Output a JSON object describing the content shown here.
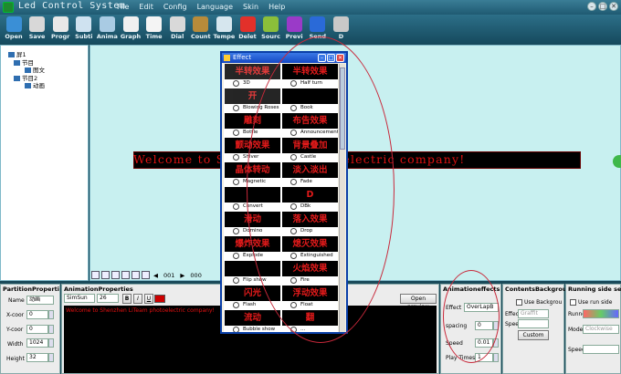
{
  "window": {
    "title": "Led Control System",
    "close": "✕",
    "minimize": "–",
    "maximize": "□"
  },
  "menu": [
    "File",
    "Edit",
    "Config",
    "Language",
    "Skin",
    "Help"
  ],
  "toolbar": [
    {
      "label": "Open",
      "icon": "folder-open-icon",
      "color": "#3a8fd6"
    },
    {
      "label": "Save",
      "icon": "floppy-disk-icon",
      "color": "#d8d8d8"
    },
    {
      "label": "Progr",
      "icon": "program-icon",
      "color": "#e8e8e8"
    },
    {
      "label": "Subti",
      "icon": "subtitle-icon",
      "color": "#cfe2f0"
    },
    {
      "label": "Anima",
      "icon": "animation-icon",
      "color": "#a9cbe3"
    },
    {
      "label": "Graph",
      "icon": "graph-icon",
      "color": "#f0f0f0"
    },
    {
      "label": "Time",
      "icon": "time-icon",
      "color": "#f4f4f4"
    },
    {
      "label": "Dial",
      "icon": "dial-clock-icon",
      "color": "#d9d9d9"
    },
    {
      "label": "Count",
      "icon": "hourglass-icon",
      "color": "#b88b3a"
    },
    {
      "label": "Tempe",
      "icon": "temperature-cloud-icon",
      "color": "#d6e6ee"
    },
    {
      "label": "Delet",
      "icon": "delete-x-icon",
      "color": "#e2302a"
    },
    {
      "label": "Sourc",
      "icon": "source-icon",
      "color": "#8bbf3a"
    },
    {
      "label": "Previ",
      "icon": "preview-play-icon",
      "color": "#9a3ac8"
    },
    {
      "label": "Send",
      "icon": "send-icon",
      "color": "#2a6ad8"
    },
    {
      "label": "D",
      "icon": "download-icon",
      "color": "#c8c8c8"
    }
  ],
  "tree": [
    {
      "label": "屏1"
    },
    {
      "label": "节目"
    },
    {
      "label": "图文"
    },
    {
      "label": "节目2"
    },
    {
      "label": "动画"
    }
  ],
  "canvas": {
    "led_text": "Welcome to Shenzhen  in photoelectric company!"
  },
  "navbar": {
    "page": "001",
    "count": "000"
  },
  "partition": {
    "title": "PartitionProperti",
    "name_label": "Name",
    "name_value": "动画",
    "xcoor_label": "X-coor",
    "xcoor_value": "0",
    "ycoor_label": "Y-coor",
    "ycoor_value": "0",
    "width_label": "Width",
    "width_value": "1024",
    "height_label": "Height",
    "height_value": "32"
  },
  "animprops": {
    "title": "AnimationProperties",
    "font": "SimSun",
    "size": "26",
    "bold": "B",
    "italic": "I",
    "underline": "U",
    "open_preview": "Open preview",
    "text": "Welcome to Shenzhen LiTeam photoelectric company!",
    "text_color": "#cc0000"
  },
  "animeffects": {
    "title": "Animationeffects",
    "effect_label": "Effect",
    "effect_value": "OverLapB",
    "spacing_label": "spacing",
    "spacing_value": "0",
    "speed_label": "Speed",
    "speed_value": "0.01",
    "playtimes_label": "Play Times",
    "playtimes_value": "1"
  },
  "bgpanel": {
    "title": "ContentsBackground",
    "use_bg": "Use Backgrou",
    "effect_label": "Effec",
    "effect_value": "Graffit",
    "speed_label": "Speed",
    "custom": "Custom"
  },
  "runside": {
    "title": "Running side setting",
    "use_run": "Use run side",
    "runner_label": "Runne",
    "mode_label": "Mode",
    "mode_value": "Clockwise",
    "speed_label": "Speed"
  },
  "effect_dialog": {
    "title": "Effect",
    "items": [
      {
        "preview": "半转效果",
        "name": "3D",
        "dim": true
      },
      {
        "preview": "半转效果",
        "name": "Half turn"
      },
      {
        "preview": "开",
        "name": "Blowing Roses",
        "dim": true
      },
      {
        "preview": "",
        "name": "Book"
      },
      {
        "preview": "雕刻",
        "name": "Bottle"
      },
      {
        "preview": "布告效果",
        "name": "Announcement"
      },
      {
        "preview": "颤动效果",
        "name": "Shiver"
      },
      {
        "preview": "背景叠加",
        "name": "Castle"
      },
      {
        "preview": "晶体转动",
        "name": "Magnetic"
      },
      {
        "preview": "淡入淡出",
        "name": "Fade"
      },
      {
        "preview": "",
        "name": "Convert"
      },
      {
        "preview": "D",
        "name": "DBk"
      },
      {
        "preview": "滑动",
        "name": "Domino"
      },
      {
        "preview": "落入效果",
        "name": "Drop"
      },
      {
        "preview": "爆炸效果",
        "name": "Explode"
      },
      {
        "preview": "熄灭效果",
        "name": "Extinguished"
      },
      {
        "preview": "",
        "name": "Flip show"
      },
      {
        "preview": "火焰效果",
        "name": "Fire"
      },
      {
        "preview": "闪光",
        "name": "Flash"
      },
      {
        "preview": "浮动效果",
        "name": "Float"
      },
      {
        "preview": "流动",
        "name": "Bubble show"
      },
      {
        "preview": "翻",
        "name": "..."
      }
    ]
  }
}
